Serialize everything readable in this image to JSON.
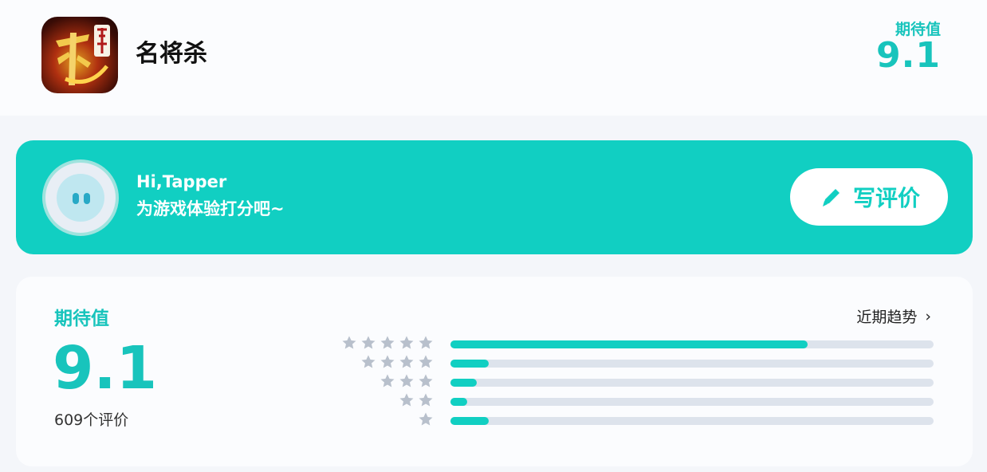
{
  "header": {
    "app_name": "名将杀",
    "score_label": "期待值",
    "score": "9.1",
    "app_icon": "game-logo-icon"
  },
  "banner": {
    "greeting": "Hi,Tapper",
    "prompt": "为游戏体验打分吧~",
    "write_button_label": "写评价",
    "write_button_icon": "pen-icon",
    "avatar_icon": "avatar-icon"
  },
  "rating": {
    "label": "期待值",
    "score": "9.1",
    "count_text": "609个评价",
    "trend_label": "近期趋势",
    "trend_icon": "chevron-right-icon",
    "distribution": [
      {
        "stars": 5,
        "fraction": 0.74
      },
      {
        "stars": 4,
        "fraction": 0.08
      },
      {
        "stars": 3,
        "fraction": 0.055
      },
      {
        "stars": 2,
        "fraction": 0.035
      },
      {
        "stars": 1,
        "fraction": 0.08
      }
    ]
  },
  "colors": {
    "accent": "#11cfc2",
    "score_text": "#18c4bc",
    "track": "#dde3ec",
    "star": "#b8c0cc"
  }
}
